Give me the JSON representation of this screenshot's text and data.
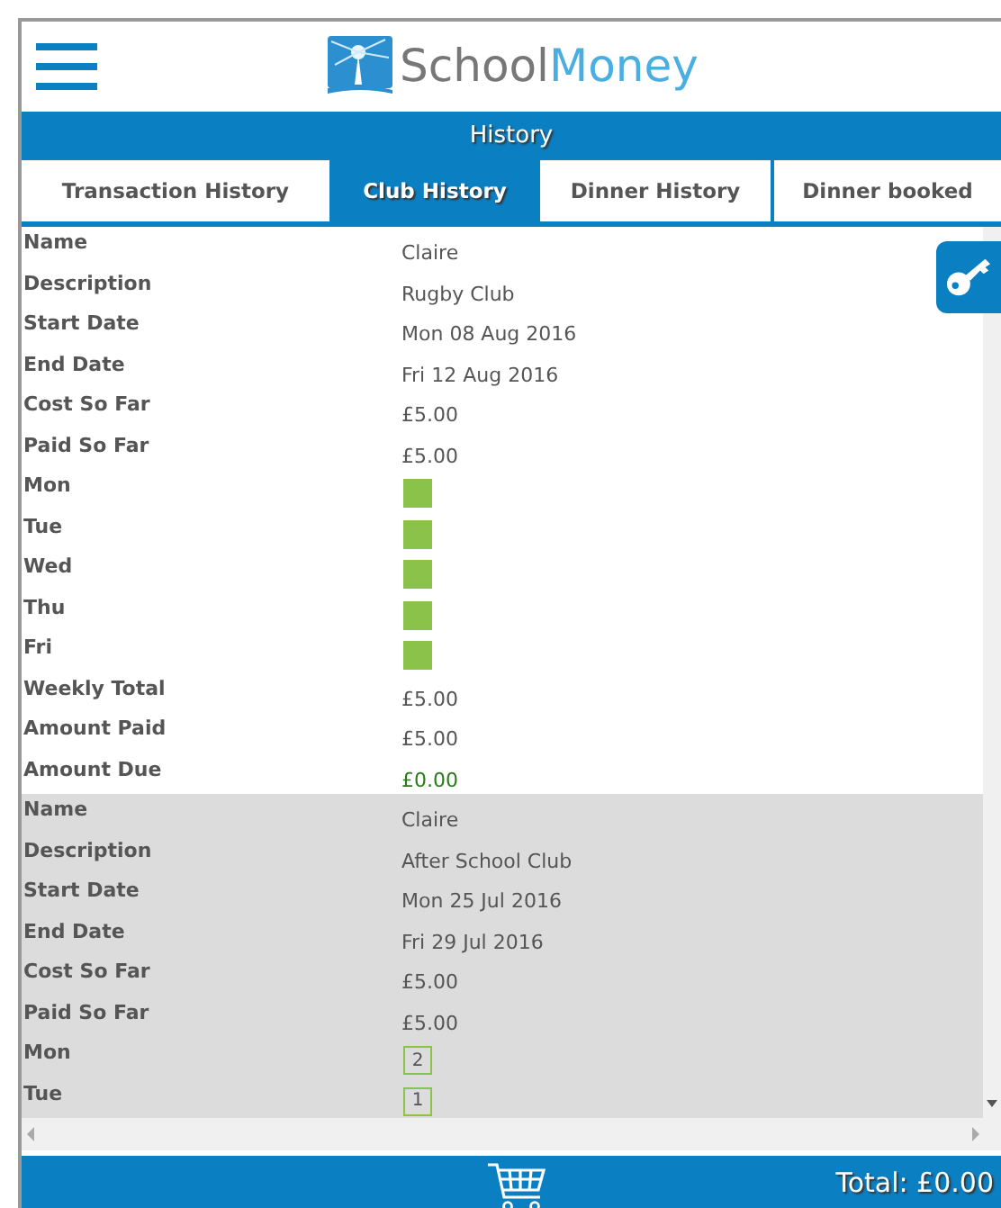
{
  "header": {
    "logo_text_dark": "School",
    "logo_text_light": "Money"
  },
  "title": "History",
  "tabs": [
    {
      "label": "Transaction History",
      "selected": false
    },
    {
      "label": "Club History",
      "selected": true
    },
    {
      "label": "Dinner History",
      "selected": false
    },
    {
      "label": "Dinner booked",
      "selected": false
    }
  ],
  "clubs": [
    {
      "rows": [
        {
          "label": "Name",
          "kind": "text",
          "value": "Claire"
        },
        {
          "label": "Description",
          "kind": "text",
          "value": "Rugby Club"
        },
        {
          "label": "Start Date",
          "kind": "text",
          "value": "Mon 08 Aug 2016"
        },
        {
          "label": "End Date",
          "kind": "text",
          "value": "Fri 12 Aug 2016"
        },
        {
          "label": "Cost So Far",
          "kind": "text",
          "value": "£5.00"
        },
        {
          "label": "Paid So Far",
          "kind": "text",
          "value": "£5.00"
        },
        {
          "label": "Mon",
          "kind": "attended"
        },
        {
          "label": "Tue",
          "kind": "attended"
        },
        {
          "label": "Wed",
          "kind": "attended"
        },
        {
          "label": "Thu",
          "kind": "attended"
        },
        {
          "label": "Fri",
          "kind": "attended"
        },
        {
          "label": "Weekly Total",
          "kind": "text",
          "value": "£5.00"
        },
        {
          "label": "Amount Paid",
          "kind": "text",
          "value": "£5.00"
        },
        {
          "label": "Amount Due",
          "kind": "due",
          "value": "£0.00"
        }
      ]
    },
    {
      "rows": [
        {
          "label": "Name",
          "kind": "text",
          "value": "Claire"
        },
        {
          "label": "Description",
          "kind": "text",
          "value": "After School Club"
        },
        {
          "label": "Start Date",
          "kind": "text",
          "value": "Mon 25 Jul 2016"
        },
        {
          "label": "End Date",
          "kind": "text",
          "value": "Fri 29 Jul 2016"
        },
        {
          "label": "Cost So Far",
          "kind": "text",
          "value": "£5.00"
        },
        {
          "label": "Paid So Far",
          "kind": "text",
          "value": "£5.00"
        },
        {
          "label": "Mon",
          "kind": "count",
          "value": "2"
        },
        {
          "label": "Tue",
          "kind": "count",
          "value": "1"
        }
      ]
    }
  ],
  "footer": {
    "total": "Total: £0.00"
  }
}
